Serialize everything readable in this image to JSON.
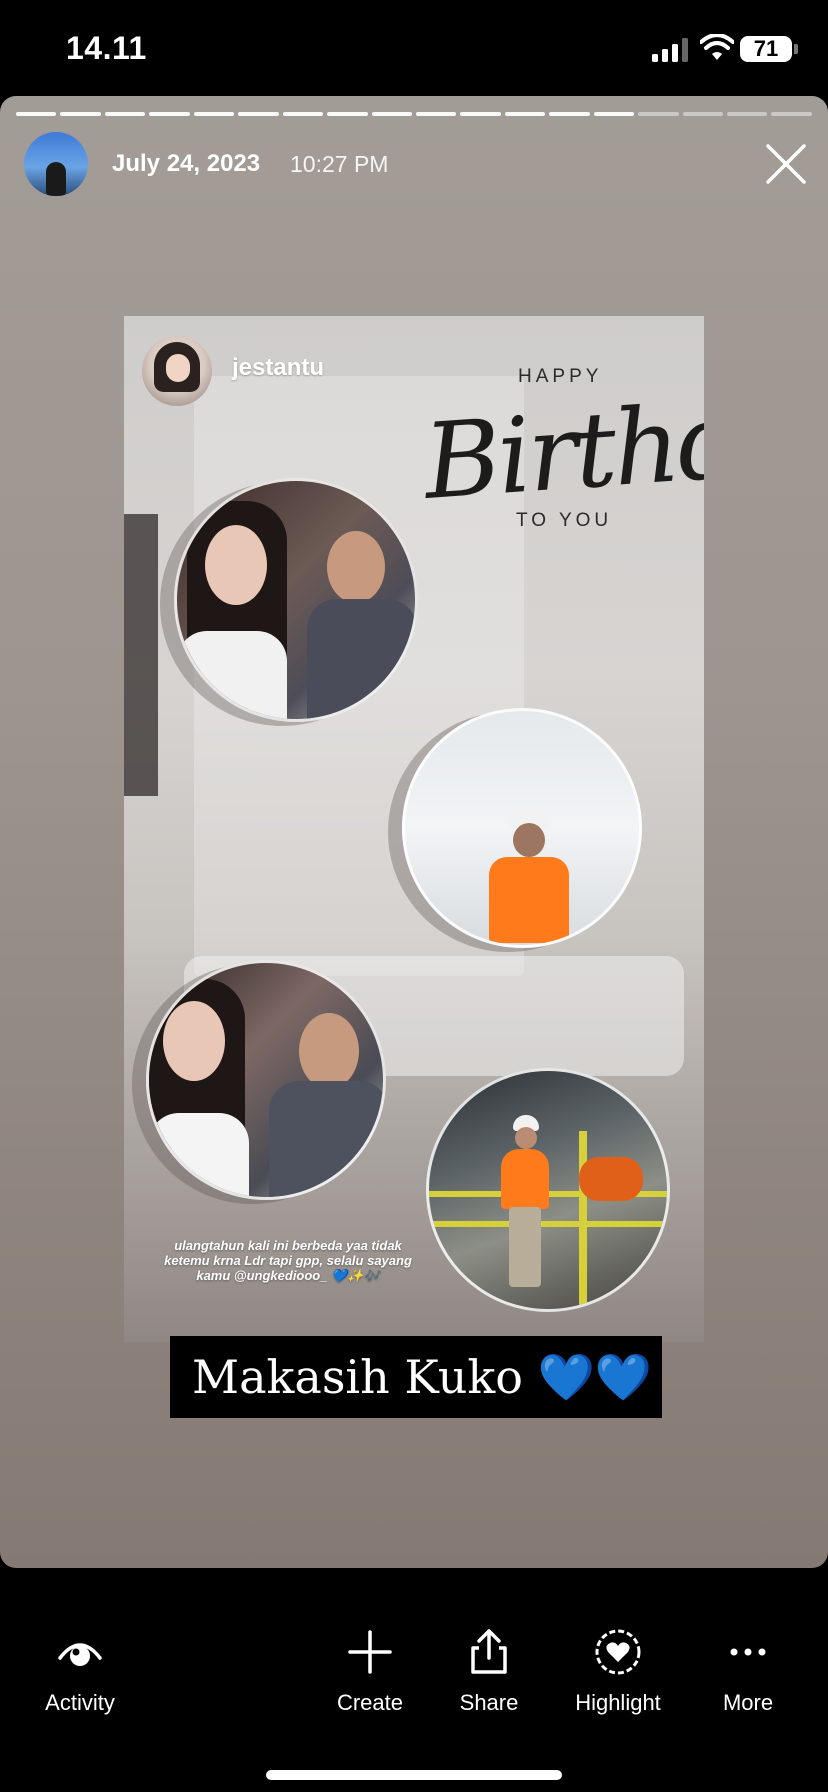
{
  "status_bar": {
    "time": "14.11",
    "battery": "71"
  },
  "story": {
    "date": "July 24, 2023",
    "time": "10:27 PM",
    "progress": {
      "segments": 18,
      "completed": 14
    }
  },
  "shared_post": {
    "username": "jestantu",
    "greeting": {
      "happy": "HAPPY",
      "birthday": "Birthday",
      "to_you": "TO YOU"
    },
    "caption": "ulangtahun kali ini berbeda yaa tidak ketemu krna Ldr tapi gpp, selalu sayang kamu @ungkediooo_ 💙✨🎶",
    "reply_text": "Makasih Kuko 💙💙"
  },
  "toolbar": {
    "activity": "Activity",
    "create": "Create",
    "share": "Share",
    "highlight": "Highlight",
    "more": "More"
  },
  "icons": [
    "signal-icon",
    "wifi-icon",
    "battery-icon",
    "close-icon",
    "eye-icon",
    "plus-icon",
    "share-icon",
    "heart-icon",
    "more-icon"
  ]
}
